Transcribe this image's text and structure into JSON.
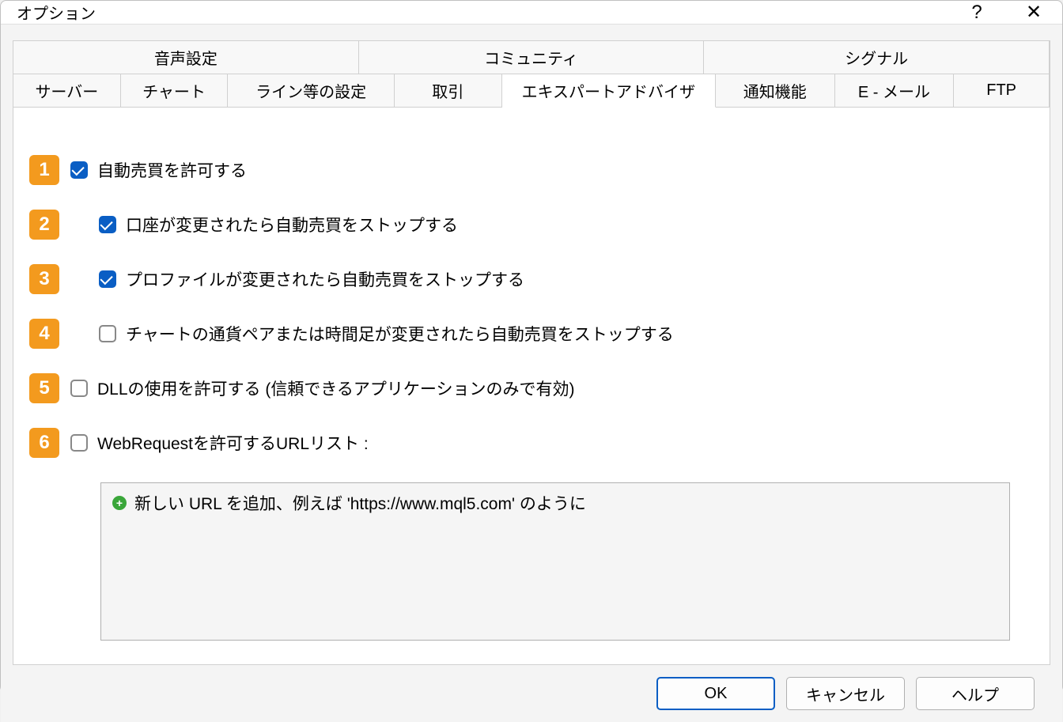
{
  "dialog": {
    "title": "オプション"
  },
  "tabs": {
    "row1": [
      "音声設定",
      "コミュニティ",
      "シグナル"
    ],
    "row2": [
      "サーバー",
      "チャート",
      "ライン等の設定",
      "取引",
      "エキスパートアドバイザ",
      "通知機能",
      "E - メール",
      "FTP"
    ]
  },
  "options": {
    "item1": {
      "num": "1",
      "label": "自動売買を許可する",
      "checked": true
    },
    "item2": {
      "num": "2",
      "label": "口座が変更されたら自動売買をストップする",
      "checked": true
    },
    "item3": {
      "num": "3",
      "label": "プロファイルが変更されたら自動売買をストップする",
      "checked": true
    },
    "item4": {
      "num": "4",
      "label": "チャートの通貨ペアまたは時間足が変更されたら自動売買をストップする",
      "checked": false
    },
    "item5": {
      "num": "5",
      "label": "DLLの使用を許可する (信頼できるアプリケーションのみで有効)",
      "checked": false
    },
    "item6": {
      "num": "6",
      "label": "WebRequestを許可するURLリスト :",
      "checked": false
    }
  },
  "urllist": {
    "placeholder": "新しい URL を追加、例えば 'https://www.mql5.com' のように"
  },
  "buttons": {
    "ok": "OK",
    "cancel": "キャンセル",
    "help": "ヘルプ"
  }
}
